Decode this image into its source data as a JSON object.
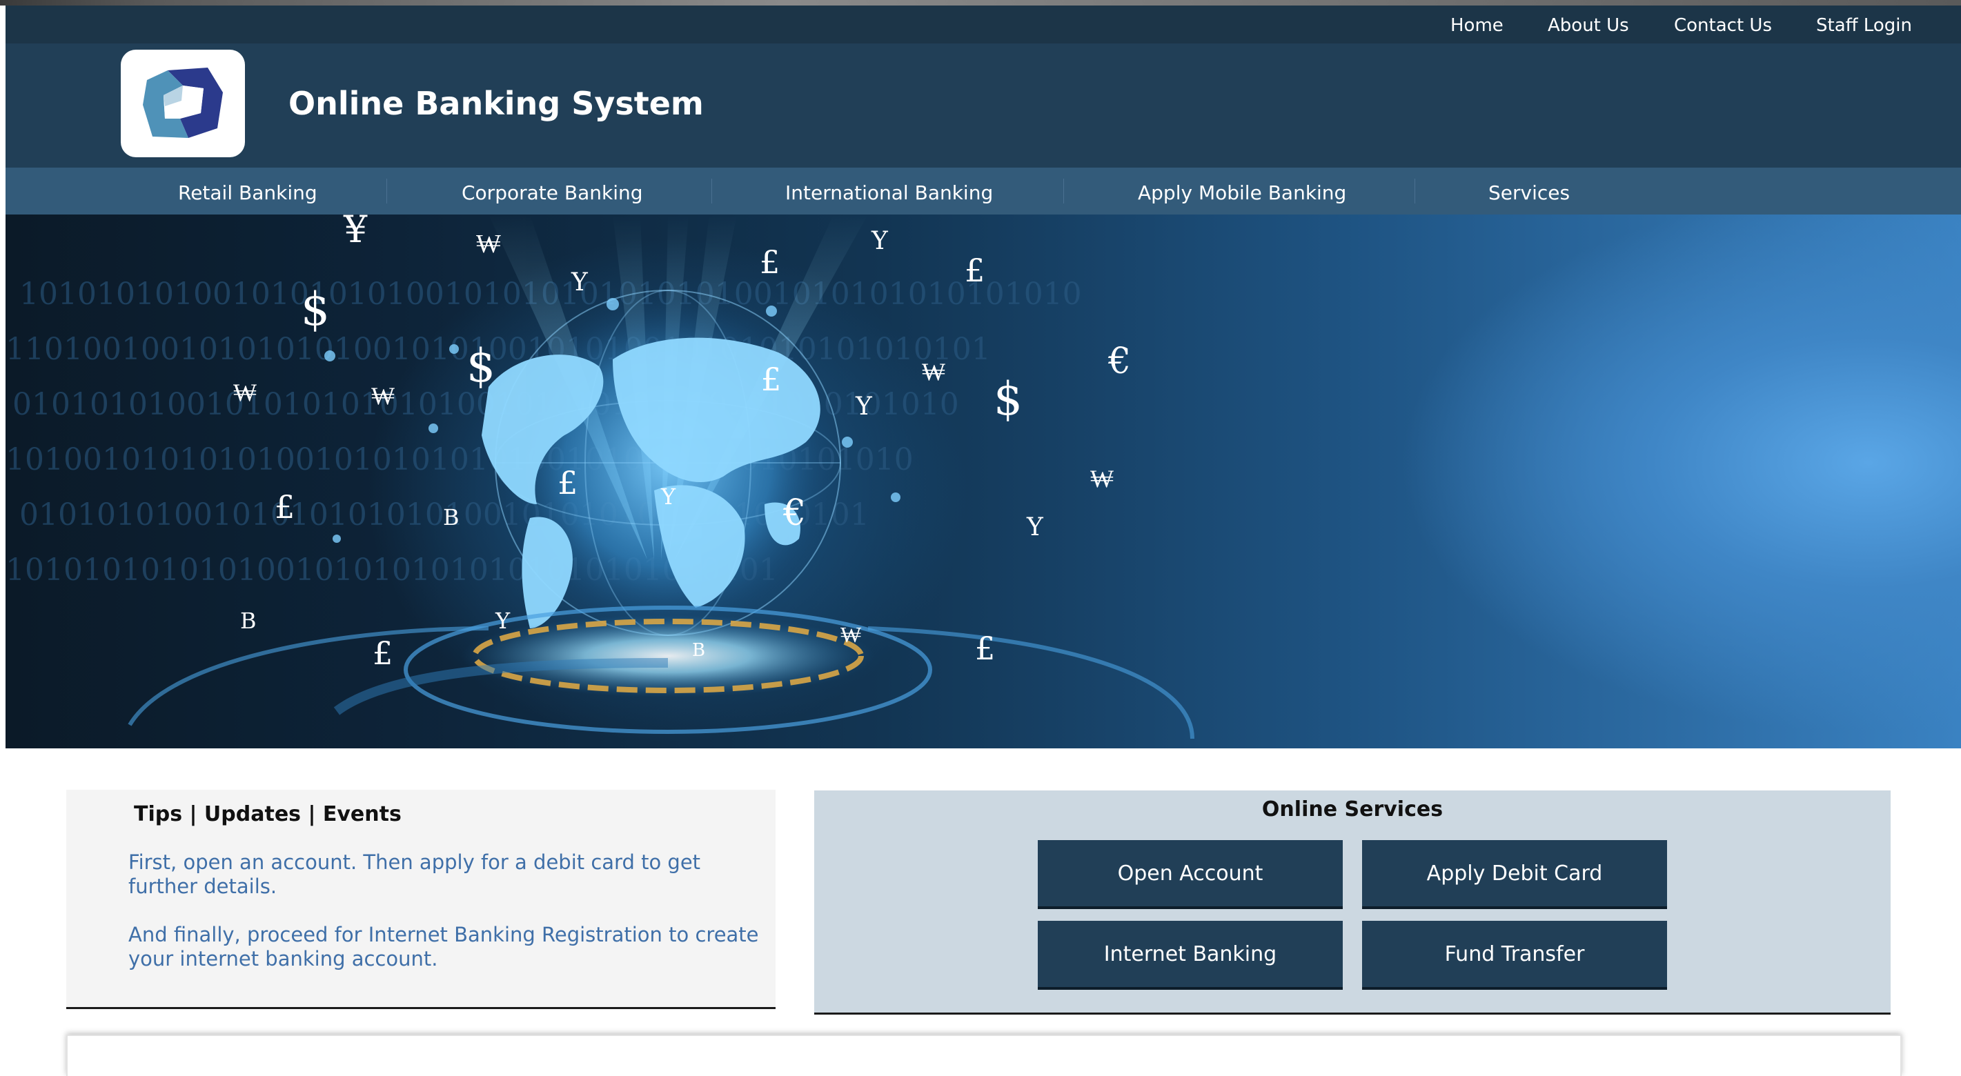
{
  "header": {
    "top_links": [
      "Home",
      "About Us",
      "Contact Us",
      "Staff Login"
    ],
    "title": "Online Banking System",
    "logo_icon": "bank-logo-icon",
    "colors": {
      "top": "#1c3548",
      "brand": "#213f57",
      "nav": "#335b7a"
    }
  },
  "nav": {
    "items": [
      "Retail Banking",
      "Corporate Banking",
      "International Banking",
      "Apply Mobile Banking",
      "Services"
    ]
  },
  "hero": {
    "image": "globe-currency-banner",
    "symbols": [
      "¥",
      "₩",
      "Y",
      "£",
      "Y",
      "£",
      "$",
      "$",
      "₩",
      "₩",
      "£",
      "Y",
      "₩",
      "€",
      "$",
      "£",
      "B",
      "£",
      "Y",
      "€",
      "₩",
      "Y",
      "B",
      "£",
      "Y",
      "£",
      "₩",
      "B"
    ]
  },
  "tips": {
    "heading": "Tips | Updates | Events",
    "paragraphs": [
      "First, open an account. Then apply for a debit card to get further details.",
      "And finally, proceed for Internet Banking Registration to create your internet banking account."
    ]
  },
  "online_services": {
    "heading": "Online Services",
    "buttons": [
      "Open Account",
      "Apply Debit Card",
      "Internet Banking",
      "Fund Transfer"
    ]
  }
}
